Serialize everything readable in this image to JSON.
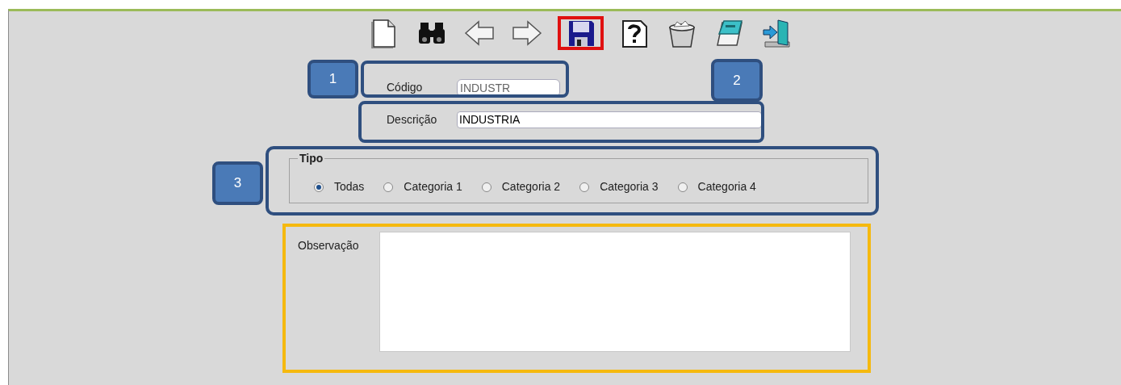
{
  "toolbar": [
    {
      "kind": "new",
      "highlighted": false
    },
    {
      "kind": "search",
      "highlighted": false
    },
    {
      "kind": "back",
      "highlighted": false
    },
    {
      "kind": "forward",
      "highlighted": false
    },
    {
      "kind": "save",
      "highlighted": true
    },
    {
      "kind": "help",
      "highlighted": false
    },
    {
      "kind": "trash",
      "highlighted": false
    },
    {
      "kind": "notes",
      "highlighted": false
    },
    {
      "kind": "exit",
      "highlighted": false
    }
  ],
  "codigo": {
    "label": "Código",
    "value": "INDUSTR",
    "disabled": true
  },
  "descricao": {
    "label": "Descrição",
    "value": "INDUSTRIA",
    "disabled": false
  },
  "tipo": {
    "legend": "Tipo",
    "options": [
      {
        "label": "Todas",
        "selected": true
      },
      {
        "label": "Categoria 1",
        "selected": false
      },
      {
        "label": "Categoria 2",
        "selected": false
      },
      {
        "label": "Categoria 3",
        "selected": false
      },
      {
        "label": "Categoria 4",
        "selected": false
      }
    ]
  },
  "observacao": {
    "label": "Observação"
  },
  "callouts": [
    {
      "number": "1"
    },
    {
      "number": "2"
    },
    {
      "number": "3"
    }
  ]
}
